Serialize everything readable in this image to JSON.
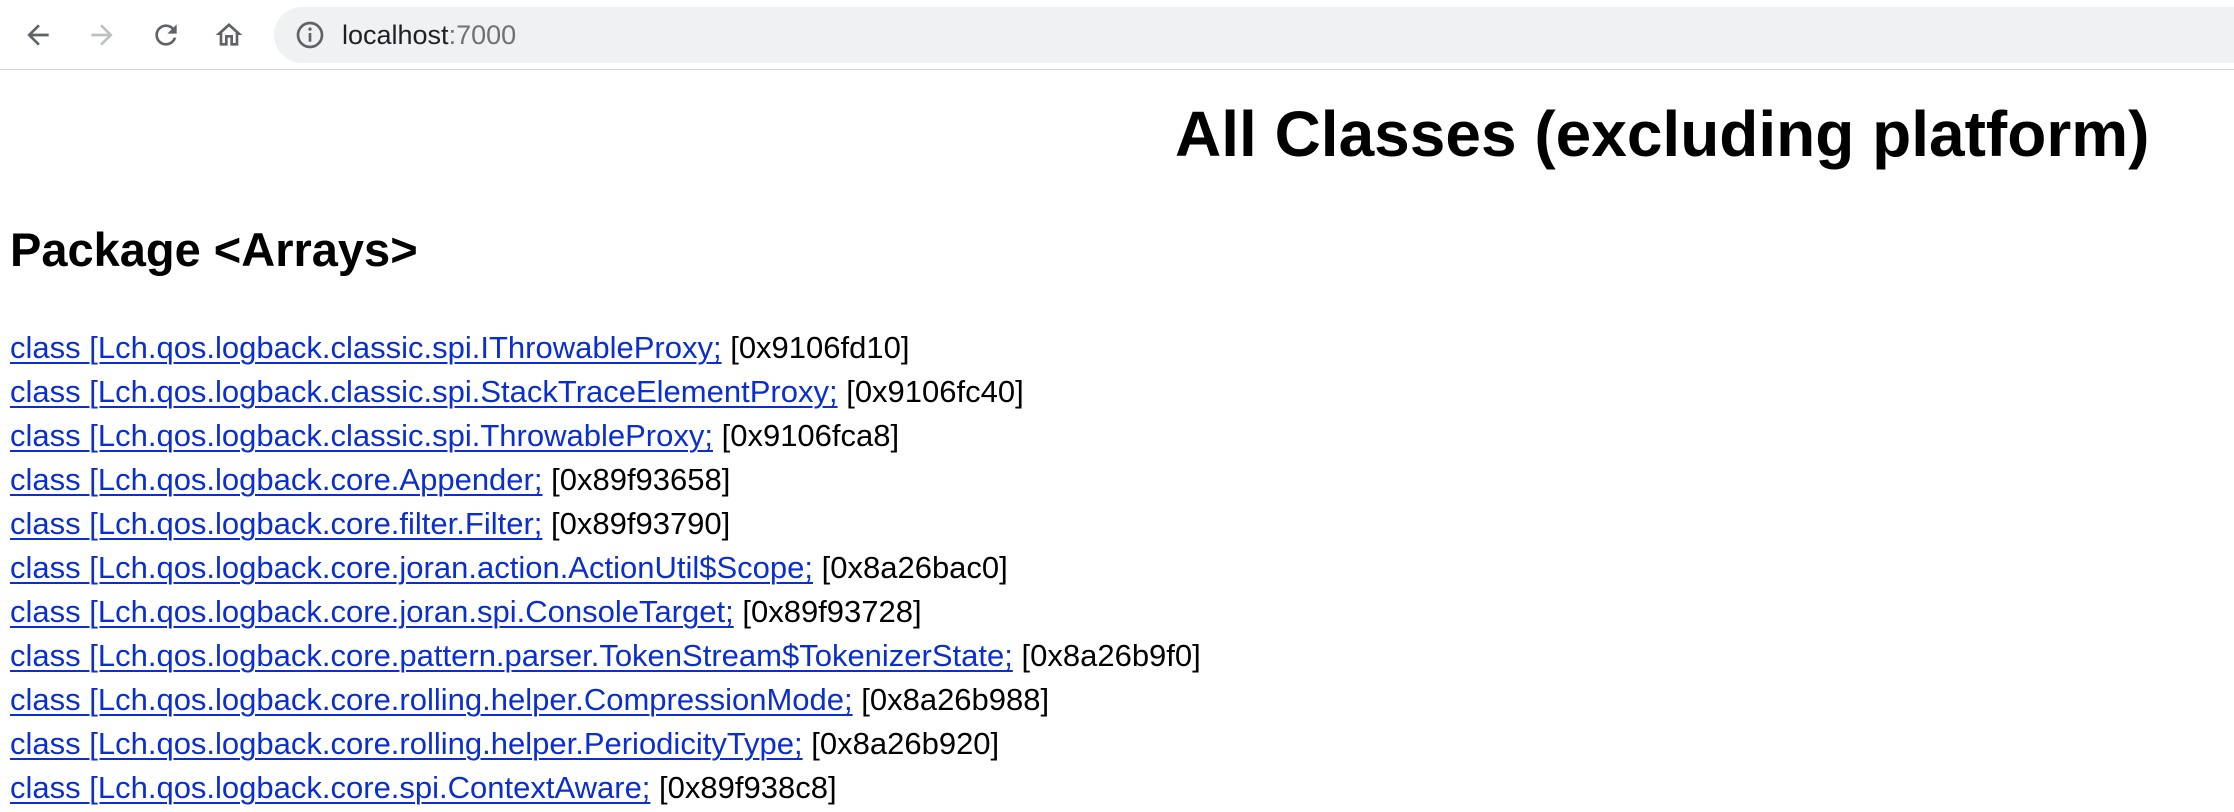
{
  "browser": {
    "url_host": "localhost",
    "url_port": ":7000",
    "icons": {
      "back": "arrow-left-icon",
      "forward": "arrow-right-icon",
      "reload": "reload-icon",
      "home": "home-icon",
      "site_info": "info-icon"
    },
    "forward_enabled": false
  },
  "page": {
    "title": "All Classes (excluding platform)",
    "section_heading": "Package <Arrays>",
    "classes": [
      {
        "name": "class [Lch.qos.logback.classic.spi.IThrowableProxy;",
        "address": "[0x9106fd10]"
      },
      {
        "name": "class [Lch.qos.logback.classic.spi.StackTraceElementProxy;",
        "address": "[0x9106fc40]"
      },
      {
        "name": "class [Lch.qos.logback.classic.spi.ThrowableProxy;",
        "address": "[0x9106fca8]"
      },
      {
        "name": "class [Lch.qos.logback.core.Appender;",
        "address": "[0x89f93658]"
      },
      {
        "name": "class [Lch.qos.logback.core.filter.Filter;",
        "address": "[0x89f93790]"
      },
      {
        "name": "class [Lch.qos.logback.core.joran.action.ActionUtil$Scope;",
        "address": "[0x8a26bac0]"
      },
      {
        "name": "class [Lch.qos.logback.core.joran.spi.ConsoleTarget;",
        "address": "[0x89f93728]"
      },
      {
        "name": "class [Lch.qos.logback.core.pattern.parser.TokenStream$TokenizerState;",
        "address": "[0x8a26b9f0]"
      },
      {
        "name": "class [Lch.qos.logback.core.rolling.helper.CompressionMode;",
        "address": "[0x8a26b988]"
      },
      {
        "name": "class [Lch.qos.logback.core.rolling.helper.PeriodicityType;",
        "address": "[0x8a26b920]"
      },
      {
        "name": "class [Lch.qos.logback.core.spi.ContextAware;",
        "address": "[0x89f938c8]"
      }
    ]
  },
  "colors": {
    "link": "#0b2ed0",
    "toolbar_icon": "#5f6368",
    "toolbar_icon_disabled": "#bdc1c6",
    "omnibox_bg": "#eff1f3"
  }
}
